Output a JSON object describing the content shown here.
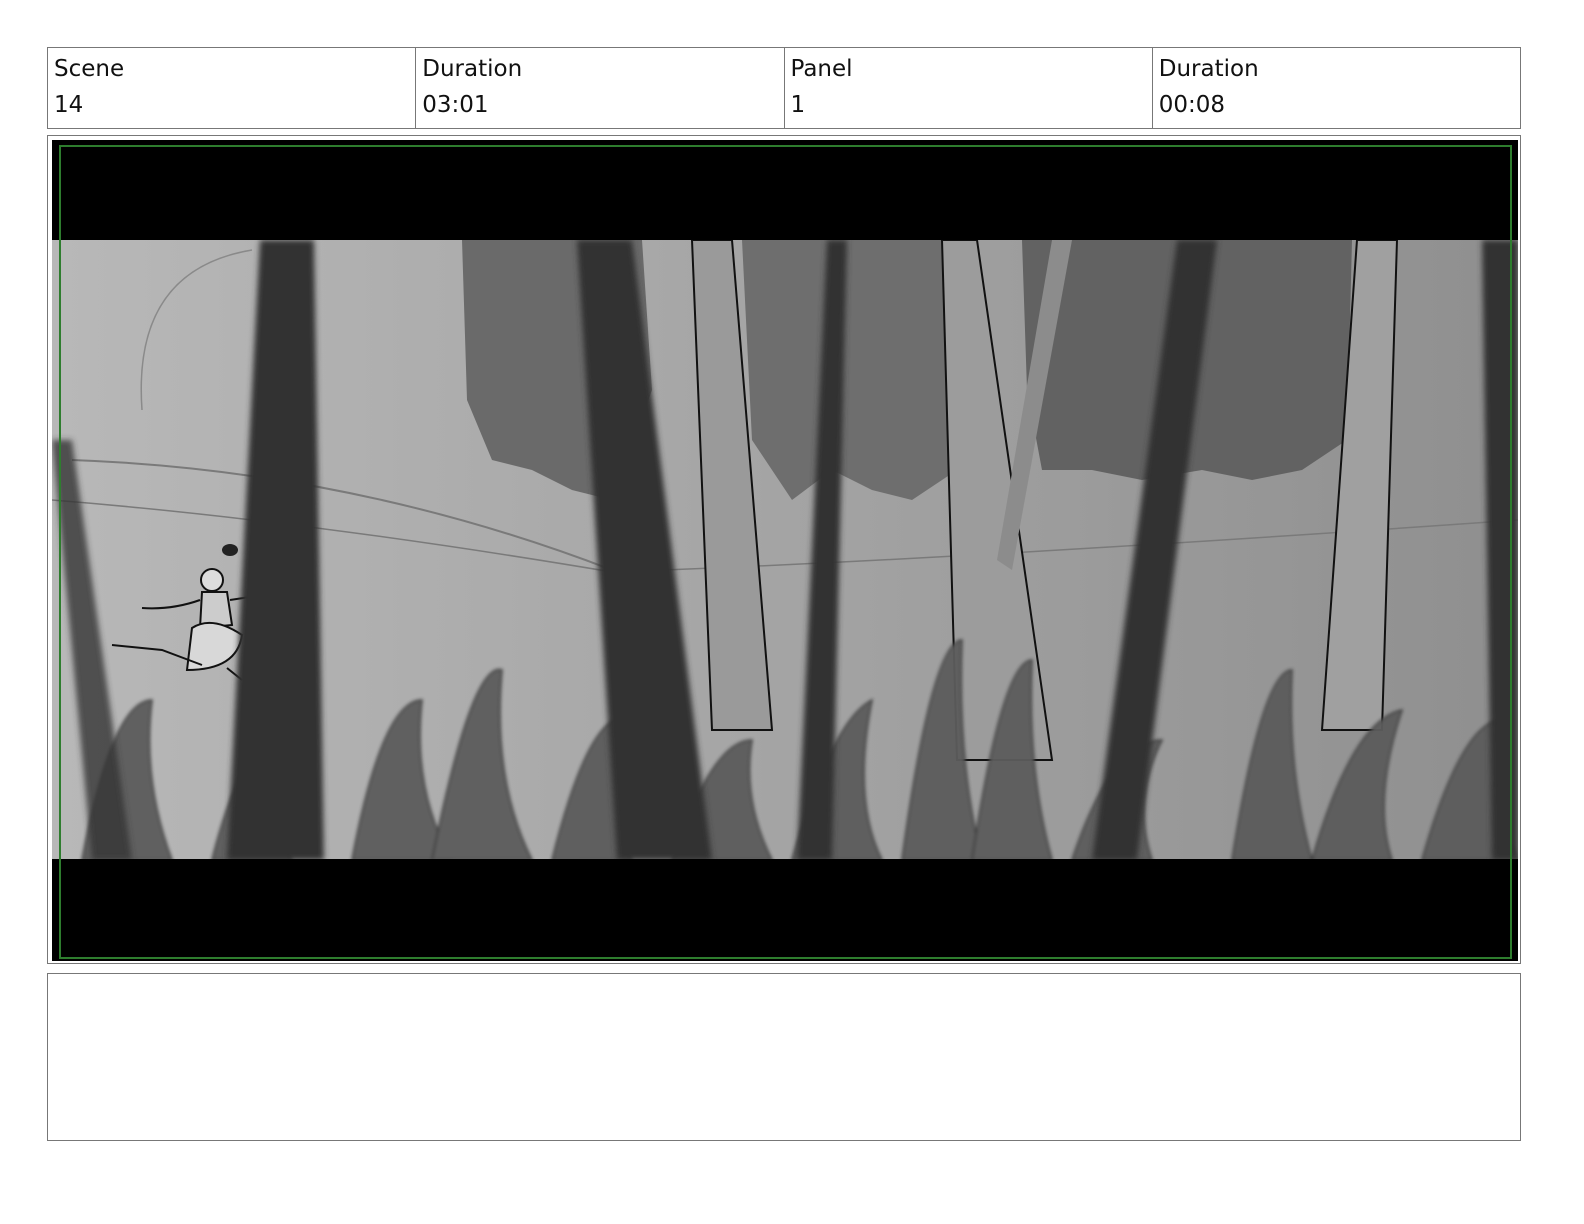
{
  "header": {
    "scene_label": "Scene",
    "scene_value": "14",
    "scene_duration_label": "Duration",
    "scene_duration_value": "03:01",
    "panel_label": "Panel",
    "panel_value": "1",
    "panel_duration_label": "Duration",
    "panel_duration_value": "00:08"
  },
  "notes": {
    "text": ""
  }
}
